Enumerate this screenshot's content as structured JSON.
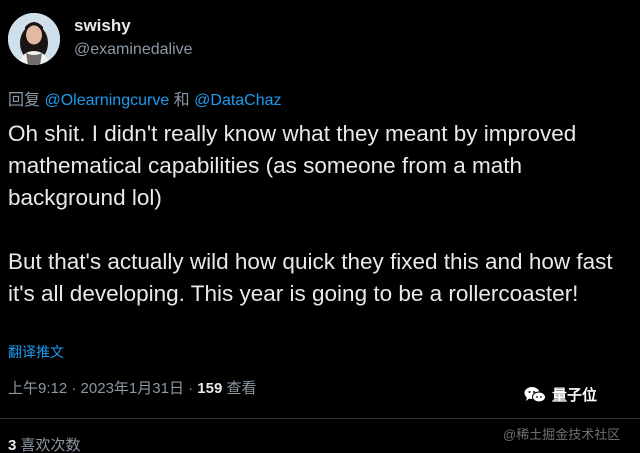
{
  "author": {
    "name": "swishy",
    "handle": "@examinedalive"
  },
  "reply": {
    "prefix": "回复",
    "mention_1": "@Olearningcurve",
    "joiner": "和",
    "mention_2": "@DataChaz"
  },
  "tweet": {
    "paragraph_1": "Oh shit. I didn't really know what they meant by improved mathematical capabilities (as someone from a math background lol)",
    "paragraph_2": "But that's actually wild how quick they fixed this and how fast it's all developing. This year is going to be a rollercoaster!"
  },
  "translate_label": "翻译推文",
  "meta": {
    "time": "上午9:12",
    "separator": "·",
    "date": "2023年1月31日",
    "views_count": "159",
    "views_label": "查看"
  },
  "stats": {
    "likes_count": "3",
    "likes_label": "喜欢次数"
  },
  "watermark": {
    "logo_text": "量子位",
    "site_text": "@稀土掘金技术社区"
  },
  "colors": {
    "background": "#000000",
    "text_primary": "#e7e9ea",
    "text_secondary": "#8b98a5",
    "link": "#1d9bf0",
    "divider": "#2f3336"
  },
  "icons": {
    "avatar": "user-photo-avatar",
    "watermark": "wechat-style-chat-bubbles-icon"
  }
}
